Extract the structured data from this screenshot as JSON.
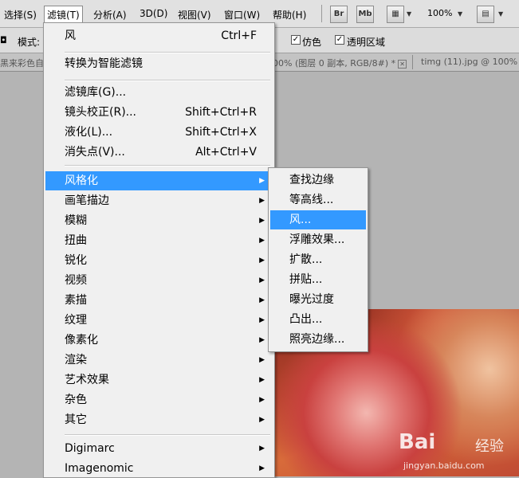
{
  "menubar": {
    "items": [
      {
        "label": "选择(S)"
      },
      {
        "label": "滤镜(T)"
      },
      {
        "label": "分析(A)"
      },
      {
        "label": "3D(D)"
      },
      {
        "label": "视图(V)"
      },
      {
        "label": "窗口(W)"
      },
      {
        "label": "帮助(H)"
      }
    ],
    "bridge_button": "Br",
    "minibridge_button": "Mb",
    "zoom_value": "100%"
  },
  "options_bar": {
    "mode_label": "模式:",
    "tab_icon_label": "◘",
    "antialias_label": "仿色",
    "transparency_label": "透明区域"
  },
  "document_tabs": {
    "tab1_partial": "黑来彩色自",
    "tab2": "00% (图层 0 副本, RGB/8#) *",
    "tab3": "timg (11).jpg @ 100% ("
  },
  "filter_menu": {
    "last_filter": {
      "label": "风",
      "shortcut": "Ctrl+F"
    },
    "convert_smart": {
      "label": "转换为智能滤镜"
    },
    "filter_gallery": {
      "label": "滤镜库(G)..."
    },
    "lens_correction": {
      "label": "镜头校正(R)...",
      "shortcut": "Shift+Ctrl+R"
    },
    "liquify": {
      "label": "液化(L)...",
      "shortcut": "Shift+Ctrl+X"
    },
    "vanishing_point": {
      "label": "消失点(V)...",
      "shortcut": "Alt+Ctrl+V"
    },
    "groups": [
      {
        "label": "风格化"
      },
      {
        "label": "画笔描边"
      },
      {
        "label": "模糊"
      },
      {
        "label": "扭曲"
      },
      {
        "label": "锐化"
      },
      {
        "label": "视频"
      },
      {
        "label": "素描"
      },
      {
        "label": "纹理"
      },
      {
        "label": "像素化"
      },
      {
        "label": "渲染"
      },
      {
        "label": "艺术效果"
      },
      {
        "label": "杂色"
      },
      {
        "label": "其它"
      }
    ],
    "plugins": [
      {
        "label": "Digimarc"
      },
      {
        "label": "Imagenomic"
      }
    ]
  },
  "stylize_submenu": {
    "items": [
      {
        "label": "查找边缘"
      },
      {
        "label": "等高线..."
      },
      {
        "label": "风..."
      },
      {
        "label": "浮雕效果..."
      },
      {
        "label": "扩散..."
      },
      {
        "label": "拼贴..."
      },
      {
        "label": "曝光过度"
      },
      {
        "label": "凸出..."
      },
      {
        "label": "照亮边缘..."
      }
    ]
  },
  "watermark": {
    "logo": "Bai",
    "text": "经验",
    "url": "jingyan.baidu.com"
  },
  "colors": {
    "highlight": "#3399ff",
    "menu_bg": "#f0f0f0",
    "menubar_bg": "#e1e1e1"
  }
}
